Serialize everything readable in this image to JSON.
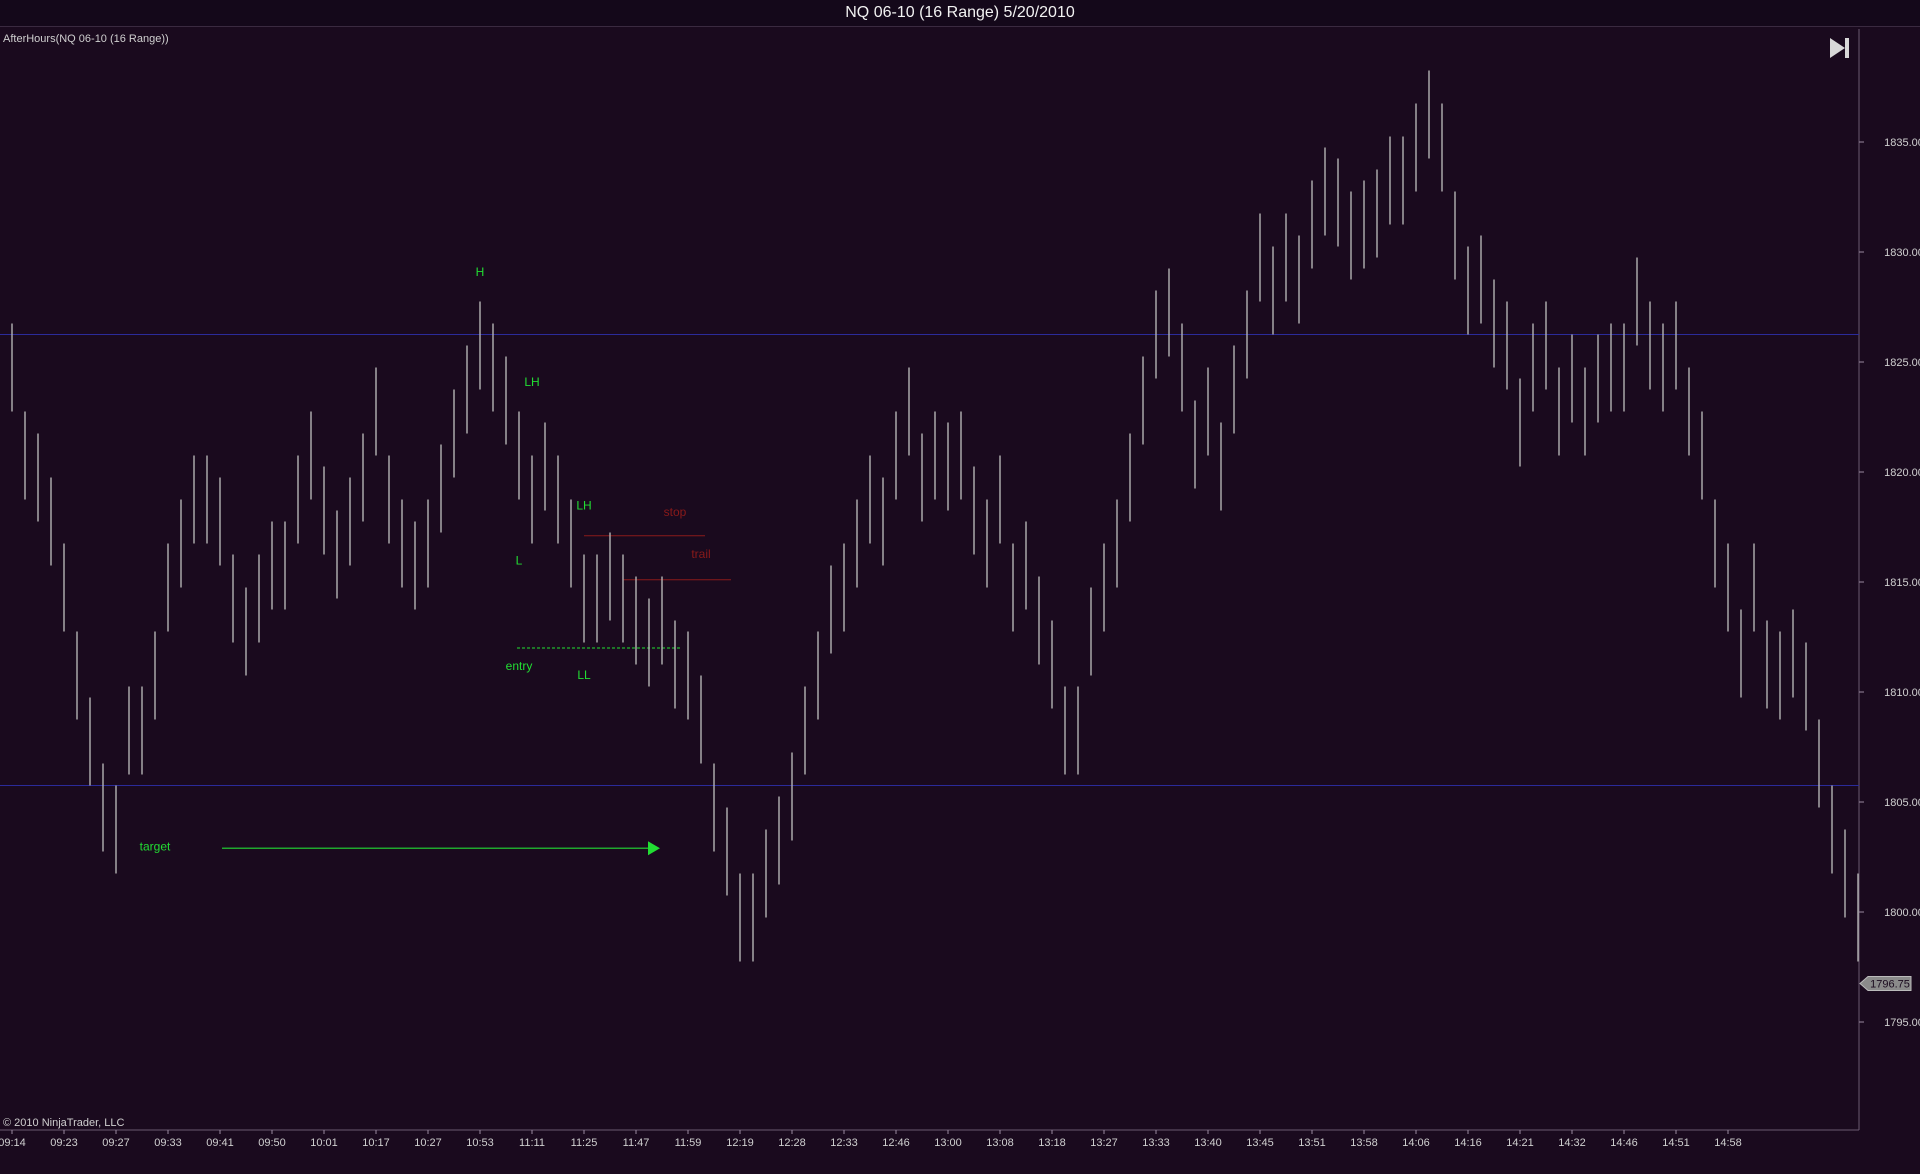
{
  "window": {
    "title": "NQ 06-10 (16 Range)  5/20/2010",
    "corner_button_label": "F"
  },
  "panel": {
    "indicator_label": "AfterHours(NQ 06-10 (16 Range))",
    "copyright": "© 2010 NinjaTrader, LLC"
  },
  "colors": {
    "background": "#1a0a1e",
    "bar": "#b4b4b4",
    "label_green": "#22dd33",
    "label_red": "#8a1a1a",
    "hline_blue": "#2b2b9a"
  },
  "chart_data": {
    "type": "range-bar",
    "title": "NQ 06-10 (16 Range)  5/20/2010",
    "ylim": [
      1790.0,
      1840.0
    ],
    "y_ticks": [
      "1835.00",
      "1830.00",
      "1825.00",
      "1820.00",
      "1815.00",
      "1810.00",
      "1805.00",
      "1800.00",
      "1795.00"
    ],
    "y_tick_values": [
      1835,
      1830,
      1825,
      1820,
      1815,
      1810,
      1805,
      1800,
      1795
    ],
    "last_price": "1796.75",
    "x_ticks": [
      "09:14",
      "09:23",
      "09:27",
      "09:33",
      "09:41",
      "09:50",
      "10:01",
      "10:17",
      "10:27",
      "10:53",
      "11:11",
      "11:25",
      "11:47",
      "11:59",
      "12:19",
      "12:28",
      "12:33",
      "12:46",
      "13:00",
      "13:08",
      "13:18",
      "13:27",
      "13:33",
      "13:40",
      "13:45",
      "13:51",
      "13:58",
      "14:06",
      "14:16",
      "14:21",
      "14:32",
      "14:46",
      "14:51",
      "14:58"
    ],
    "bars": [
      {
        "high": 1826.75,
        "low": 1822.75
      },
      {
        "high": 1822.75,
        "low": 1818.75
      },
      {
        "high": 1821.75,
        "low": 1817.75
      },
      {
        "high": 1819.75,
        "low": 1815.75
      },
      {
        "high": 1816.75,
        "low": 1812.75
      },
      {
        "high": 1812.75,
        "low": 1808.75
      },
      {
        "high": 1809.75,
        "low": 1805.75
      },
      {
        "high": 1806.75,
        "low": 1802.75
      },
      {
        "high": 1805.75,
        "low": 1801.75
      },
      {
        "high": 1810.25,
        "low": 1806.25
      },
      {
        "high": 1810.25,
        "low": 1806.25
      },
      {
        "high": 1812.75,
        "low": 1808.75
      },
      {
        "high": 1816.75,
        "low": 1812.75
      },
      {
        "high": 1818.75,
        "low": 1814.75
      },
      {
        "high": 1820.75,
        "low": 1816.75
      },
      {
        "high": 1820.75,
        "low": 1816.75
      },
      {
        "high": 1819.75,
        "low": 1815.75
      },
      {
        "high": 1816.25,
        "low": 1812.25
      },
      {
        "high": 1814.75,
        "low": 1810.75
      },
      {
        "high": 1816.25,
        "low": 1812.25
      },
      {
        "high": 1817.75,
        "low": 1813.75
      },
      {
        "high": 1817.75,
        "low": 1813.75
      },
      {
        "high": 1820.75,
        "low": 1816.75
      },
      {
        "high": 1822.75,
        "low": 1818.75
      },
      {
        "high": 1820.25,
        "low": 1816.25
      },
      {
        "high": 1818.25,
        "low": 1814.25
      },
      {
        "high": 1819.75,
        "low": 1815.75
      },
      {
        "high": 1821.75,
        "low": 1817.75
      },
      {
        "high": 1824.75,
        "low": 1820.75
      },
      {
        "high": 1820.75,
        "low": 1816.75
      },
      {
        "high": 1818.75,
        "low": 1814.75
      },
      {
        "high": 1817.75,
        "low": 1813.75
      },
      {
        "high": 1818.75,
        "low": 1814.75
      },
      {
        "high": 1821.25,
        "low": 1817.25
      },
      {
        "high": 1823.75,
        "low": 1819.75
      },
      {
        "high": 1825.75,
        "low": 1821.75
      },
      {
        "high": 1827.75,
        "low": 1823.75
      },
      {
        "high": 1826.75,
        "low": 1822.75
      },
      {
        "high": 1825.25,
        "low": 1821.25
      },
      {
        "high": 1822.75,
        "low": 1818.75
      },
      {
        "high": 1820.75,
        "low": 1816.75
      },
      {
        "high": 1822.25,
        "low": 1818.25
      },
      {
        "high": 1820.75,
        "low": 1816.75
      },
      {
        "high": 1818.75,
        "low": 1814.75
      },
      {
        "high": 1816.25,
        "low": 1812.25
      },
      {
        "high": 1816.25,
        "low": 1812.25
      },
      {
        "high": 1817.25,
        "low": 1813.25
      },
      {
        "high": 1816.25,
        "low": 1812.25
      },
      {
        "high": 1815.25,
        "low": 1811.25
      },
      {
        "high": 1814.25,
        "low": 1810.25
      },
      {
        "high": 1815.25,
        "low": 1811.25
      },
      {
        "high": 1813.25,
        "low": 1809.25
      },
      {
        "high": 1812.75,
        "low": 1808.75
      },
      {
        "high": 1810.75,
        "low": 1806.75
      },
      {
        "high": 1806.75,
        "low": 1802.75
      },
      {
        "high": 1804.75,
        "low": 1800.75
      },
      {
        "high": 1801.75,
        "low": 1797.75
      },
      {
        "high": 1801.75,
        "low": 1797.75
      },
      {
        "high": 1803.75,
        "low": 1799.75
      },
      {
        "high": 1805.25,
        "low": 1801.25
      },
      {
        "high": 1807.25,
        "low": 1803.25
      },
      {
        "high": 1810.25,
        "low": 1806.25
      },
      {
        "high": 1812.75,
        "low": 1808.75
      },
      {
        "high": 1815.75,
        "low": 1811.75
      },
      {
        "high": 1816.75,
        "low": 1812.75
      },
      {
        "high": 1818.75,
        "low": 1814.75
      },
      {
        "high": 1820.75,
        "low": 1816.75
      },
      {
        "high": 1819.75,
        "low": 1815.75
      },
      {
        "high": 1822.75,
        "low": 1818.75
      },
      {
        "high": 1824.75,
        "low": 1820.75
      },
      {
        "high": 1821.75,
        "low": 1817.75
      },
      {
        "high": 1822.75,
        "low": 1818.75
      },
      {
        "high": 1822.25,
        "low": 1818.25
      },
      {
        "high": 1822.75,
        "low": 1818.75
      },
      {
        "high": 1820.25,
        "low": 1816.25
      },
      {
        "high": 1818.75,
        "low": 1814.75
      },
      {
        "high": 1820.75,
        "low": 1816.75
      },
      {
        "high": 1816.75,
        "low": 1812.75
      },
      {
        "high": 1817.75,
        "low": 1813.75
      },
      {
        "high": 1815.25,
        "low": 1811.25
      },
      {
        "high": 1813.25,
        "low": 1809.25
      },
      {
        "high": 1810.25,
        "low": 1806.25
      },
      {
        "high": 1810.25,
        "low": 1806.25
      },
      {
        "high": 1814.75,
        "low": 1810.75
      },
      {
        "high": 1816.75,
        "low": 1812.75
      },
      {
        "high": 1818.75,
        "low": 1814.75
      },
      {
        "high": 1821.75,
        "low": 1817.75
      },
      {
        "high": 1825.25,
        "low": 1821.25
      },
      {
        "high": 1828.25,
        "low": 1824.25
      },
      {
        "high": 1829.25,
        "low": 1825.25
      },
      {
        "high": 1826.75,
        "low": 1822.75
      },
      {
        "high": 1823.25,
        "low": 1819.25
      },
      {
        "high": 1824.75,
        "low": 1820.75
      },
      {
        "high": 1822.25,
        "low": 1818.25
      },
      {
        "high": 1825.75,
        "low": 1821.75
      },
      {
        "high": 1828.25,
        "low": 1824.25
      },
      {
        "high": 1831.75,
        "low": 1827.75
      },
      {
        "high": 1830.25,
        "low": 1826.25
      },
      {
        "high": 1831.75,
        "low": 1827.75
      },
      {
        "high": 1830.75,
        "low": 1826.75
      },
      {
        "high": 1833.25,
        "low": 1829.25
      },
      {
        "high": 1834.75,
        "low": 1830.75
      },
      {
        "high": 1834.25,
        "low": 1830.25
      },
      {
        "high": 1832.75,
        "low": 1828.75
      },
      {
        "high": 1833.25,
        "low": 1829.25
      },
      {
        "high": 1833.75,
        "low": 1829.75
      },
      {
        "high": 1835.25,
        "low": 1831.25
      },
      {
        "high": 1835.25,
        "low": 1831.25
      },
      {
        "high": 1836.75,
        "low": 1832.75
      },
      {
        "high": 1838.25,
        "low": 1834.25
      },
      {
        "high": 1836.75,
        "low": 1832.75
      },
      {
        "high": 1832.75,
        "low": 1828.75
      },
      {
        "high": 1830.25,
        "low": 1826.25
      },
      {
        "high": 1830.75,
        "low": 1826.75
      },
      {
        "high": 1828.75,
        "low": 1824.75
      },
      {
        "high": 1827.75,
        "low": 1823.75
      },
      {
        "high": 1824.25,
        "low": 1820.25
      },
      {
        "high": 1826.75,
        "low": 1822.75
      },
      {
        "high": 1827.75,
        "low": 1823.75
      },
      {
        "high": 1824.75,
        "low": 1820.75
      },
      {
        "high": 1826.25,
        "low": 1822.25
      },
      {
        "high": 1824.75,
        "low": 1820.75
      },
      {
        "high": 1826.25,
        "low": 1822.25
      },
      {
        "high": 1826.75,
        "low": 1822.75
      },
      {
        "high": 1826.75,
        "low": 1822.75
      },
      {
        "high": 1829.75,
        "low": 1825.75
      },
      {
        "high": 1827.75,
        "low": 1823.75
      },
      {
        "high": 1826.75,
        "low": 1822.75
      },
      {
        "high": 1827.75,
        "low": 1823.75
      },
      {
        "high": 1824.75,
        "low": 1820.75
      },
      {
        "high": 1822.75,
        "low": 1818.75
      },
      {
        "high": 1818.75,
        "low": 1814.75
      },
      {
        "high": 1816.75,
        "low": 1812.75
      },
      {
        "high": 1813.75,
        "low": 1809.75
      },
      {
        "high": 1816.75,
        "low": 1812.75
      },
      {
        "high": 1813.25,
        "low": 1809.25
      },
      {
        "high": 1812.75,
        "low": 1808.75
      },
      {
        "high": 1813.75,
        "low": 1809.75
      },
      {
        "high": 1812.25,
        "low": 1808.25
      },
      {
        "high": 1808.75,
        "low": 1804.75
      },
      {
        "high": 1805.75,
        "low": 1801.75
      },
      {
        "high": 1803.75,
        "low": 1799.75
      },
      {
        "high": 1801.75,
        "low": 1797.75
      }
    ],
    "horizontal_lines": [
      1826.25,
      1805.75
    ],
    "annotations": [
      {
        "text": "H",
        "bar": 36,
        "price": 1828.9
      },
      {
        "text": "LH",
        "bar": 40,
        "price": 1823.9
      },
      {
        "text": "L",
        "bar": 39,
        "price": 1815.8
      },
      {
        "text": "LH",
        "bar": 44,
        "price": 1818.3
      },
      {
        "text": "entry",
        "bar": 39,
        "price": 1811.0
      },
      {
        "text": "LL",
        "bar": 44,
        "price": 1810.6
      },
      {
        "text": "target",
        "bar": 11,
        "price": 1802.8
      },
      {
        "text": "stop",
        "bar": 51,
        "price": 1818.0
      },
      {
        "text": "trail",
        "bar": 53,
        "price": 1816.1
      }
    ],
    "levels": {
      "entry": {
        "price": 1812.0,
        "from_bar": 39,
        "to_bar": 51
      },
      "stop": {
        "price": 1817.1,
        "from_bar": 44,
        "to_bar": 53
      },
      "trail": {
        "price": 1815.1,
        "from_bar": 47,
        "to_bar": 55
      },
      "target_arrow": {
        "price": 1802.9,
        "from_bar": 16,
        "to_bar": 50
      }
    }
  }
}
